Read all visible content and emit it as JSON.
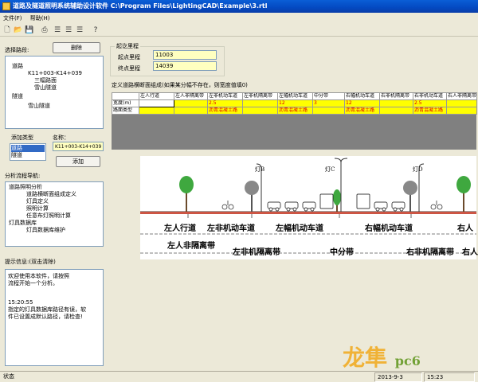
{
  "window": {
    "title": "道路及隧道照明系统辅助设计软件 C:\\Program Files\\LightingCAD\\Example\\3.rtl"
  },
  "menu": {
    "items": [
      "文件(F)",
      "帮助(H)"
    ]
  },
  "toolbar": {
    "icons": [
      "new-icon",
      "open-icon",
      "save-icon",
      "print-icon",
      "align-left-icon",
      "align-center-icon",
      "align-right-icon",
      "help-icon"
    ]
  },
  "left": {
    "select_path_label": "选择路段:",
    "delete_button": "删除",
    "tree": [
      "道路",
      "K11+003-K14+039",
      "三幅路面",
      "雪山隧道",
      "隧道",
      "雪山隧道"
    ],
    "add_type_label": "添加类型",
    "types": [
      "道路",
      "隧道"
    ],
    "name_label": "名称：",
    "name_value": "K11+003-K14+039",
    "add_button": "添加",
    "nav_label": "分析流程导航:",
    "nav_tree": [
      "道路照明分析",
      "道路横断面组成定义",
      "灯具定义",
      "照明计算",
      "任意布灯照明计算",
      "灯具数据库",
      "灯具数据库维护"
    ],
    "hint_label": "提示信息:(双击清除)",
    "hint_text": [
      "欢迎使用本软件，请按照",
      "流程开始一个分析。",
      "",
      "15:20:55",
      "指定的灯具数据库路径有误，软",
      "件已设置成默认路径，请检查!"
    ]
  },
  "mileage": {
    "group_label": "起讫里程",
    "start_label": "起点里程",
    "start_value": "11003",
    "end_label": "终点里程",
    "end_value": "14039"
  },
  "section": {
    "label": "定义道路横断面组成(如果某分幅不存在，则宽度值填0)",
    "headers": [
      "",
      "左人行道",
      "左人非隔离带",
      "左非机动车道",
      "左非机隔离带",
      "左幅机动车道",
      "中分带",
      "右幅机动车道",
      "右非机隔离带",
      "右非机动车道",
      "右人非隔离带"
    ],
    "width_row": [
      "宽度(m)",
      "",
      "",
      "2.5",
      "",
      "12",
      "3",
      "12",
      "",
      "2.5",
      ""
    ],
    "surface_row": [
      "路面类型",
      "",
      "",
      "沥青混凝土路",
      "",
      "沥青混凝土路",
      "",
      "沥青混凝土路",
      "",
      "沥青混凝土路",
      ""
    ]
  },
  "diagram": {
    "lamps": [
      "灯B",
      "灯C",
      "灯D"
    ],
    "labels_top": [
      "左人行道",
      "左非机动车道",
      "左幅机动车道",
      "右幅机动车道",
      "右人"
    ],
    "labels_bottom": [
      "左人非隔离带",
      "左非机隔离带",
      "中分带",
      "右非机隔离带",
      "右人"
    ]
  },
  "status": {
    "text": "状态",
    "date": "2013-9-3",
    "time": "15:23"
  },
  "watermark": {
    "text": "龙隼",
    "sub": "pc6"
  }
}
